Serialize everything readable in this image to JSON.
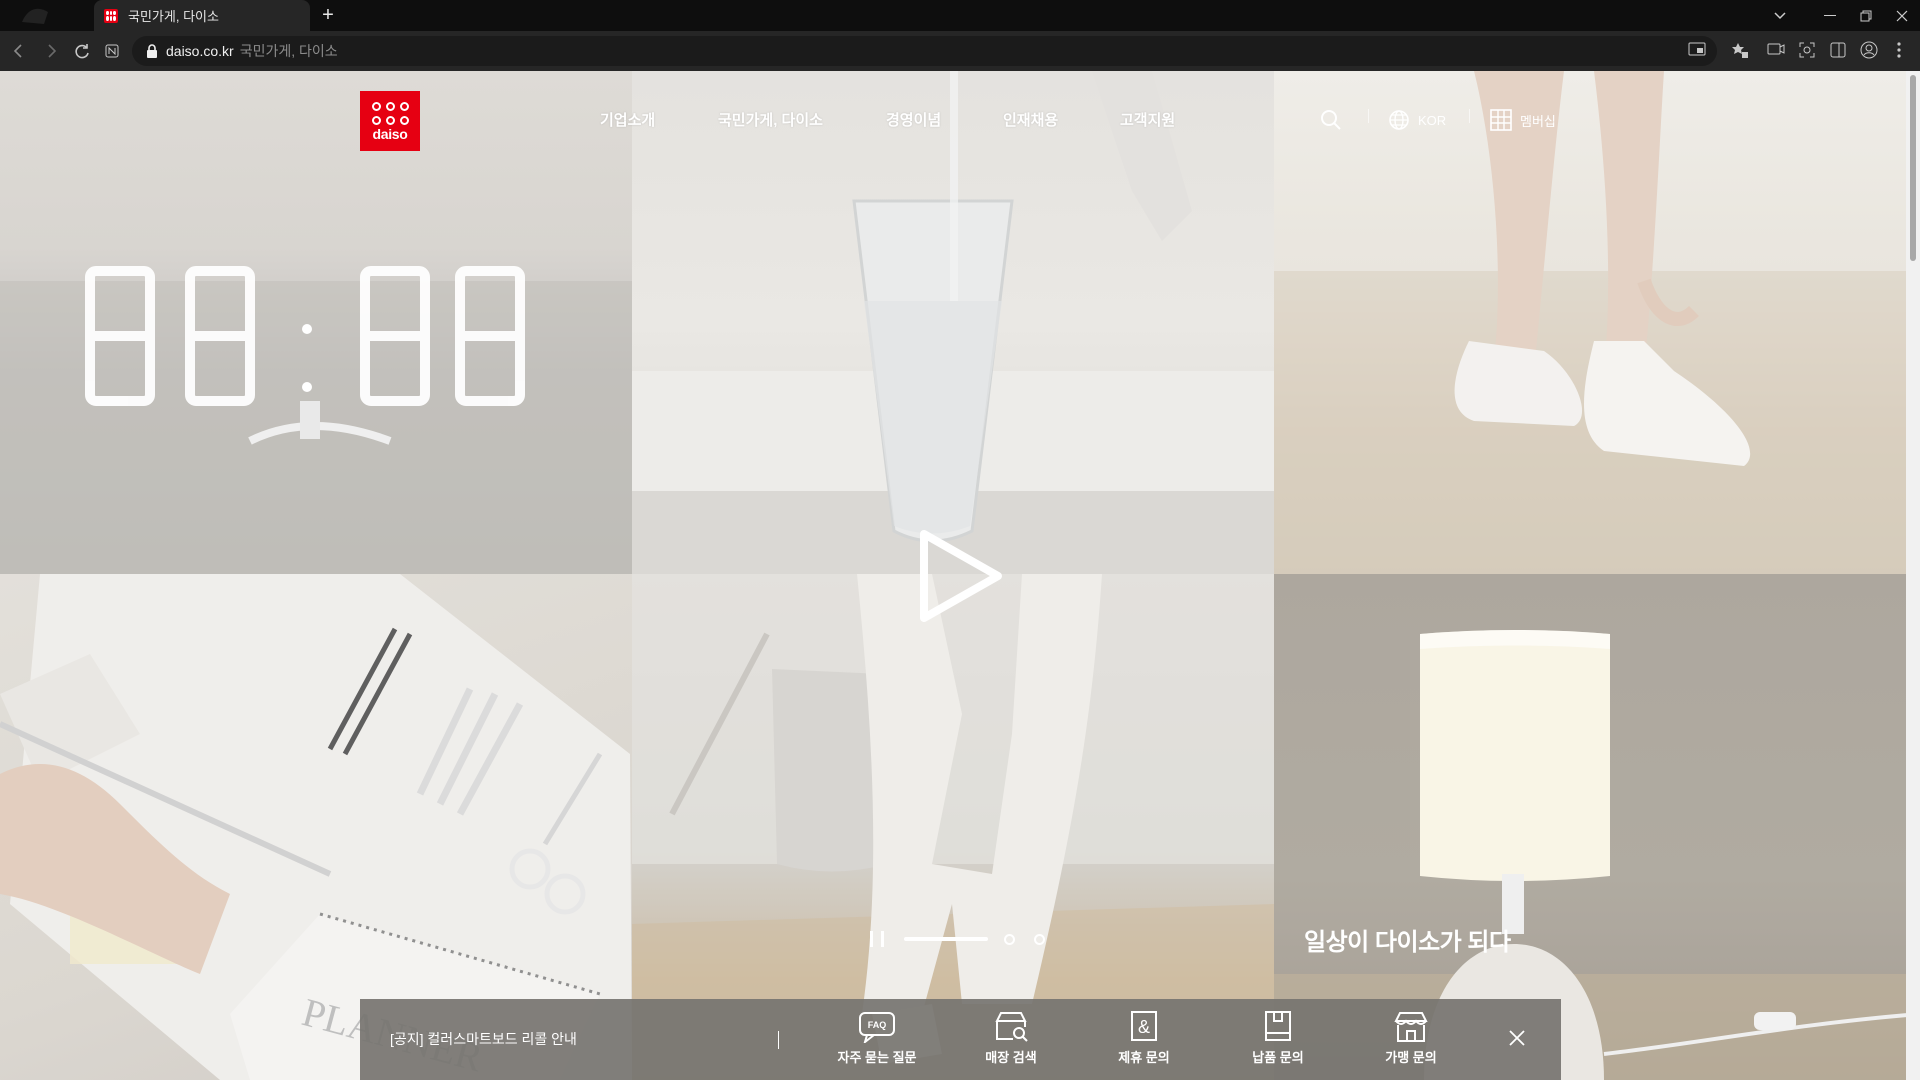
{
  "browser": {
    "tab_title": "국민가게, 다이소",
    "new_tab_label": "+",
    "url_domain": "daiso.co.kr",
    "url_page_title": "국민가게, 다이소",
    "window_controls": [
      "minimize-icon",
      "restore-icon",
      "close-icon"
    ],
    "toolbar_icons": [
      "cast-icon",
      "extensions-icon",
      "screenshot-icon",
      "camera-icon",
      "sidepanel-icon",
      "profile-icon",
      "menu-icon"
    ]
  },
  "site": {
    "logo_text": "daiso",
    "brand_color": "#e60012",
    "nav": [
      "기업소개",
      "국민가게, 다이소",
      "경영이념",
      "인재채용",
      "고객지원"
    ],
    "language": "KOR",
    "membership": "멤버십",
    "hero_slogan": "일상이 다이소가 되다",
    "slider": {
      "current": 1,
      "total": 3
    },
    "notice": "[공지] 컬러스마트보드 리콜 안내",
    "quick_links": [
      {
        "label": "자주 묻는 질문",
        "icon": "faq-icon"
      },
      {
        "label": "매장 검색",
        "icon": "store-search-icon"
      },
      {
        "label": "제휴 문의",
        "icon": "partnership-icon"
      },
      {
        "label": "납품 문의",
        "icon": "supply-icon"
      },
      {
        "label": "가맹 문의",
        "icon": "franchise-icon"
      }
    ],
    "faq_badge": "FAQ"
  }
}
